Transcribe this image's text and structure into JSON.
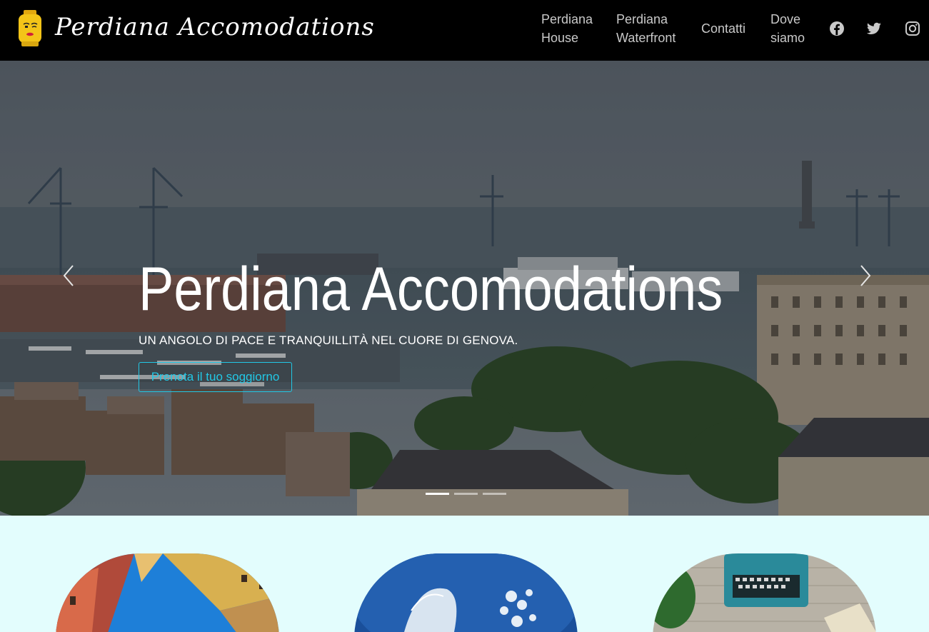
{
  "brand": {
    "name": "Perdiana Accomodations",
    "logo_icon": "lego-head-icon"
  },
  "nav": {
    "items": [
      {
        "line1": "Perdiana",
        "line2": "House"
      },
      {
        "line1": "Perdiana",
        "line2": "Waterfront"
      },
      {
        "line1": "Contatti",
        "line2": ""
      },
      {
        "line1": "Dove",
        "line2": "siamo"
      }
    ],
    "social_icons": [
      "facebook-icon",
      "twitter-icon",
      "instagram-icon"
    ]
  },
  "hero": {
    "title": "Perdiana Accomodations",
    "subtitle": "UN ANGOLO DI PACE E TRANQUILLITÀ NEL CUORE DI GENOVA.",
    "cta_label": "Prenota il tuo soggiorno",
    "slides_count": 3,
    "active_slide": 1,
    "prev_icon": "chevron-left-icon",
    "next_icon": "chevron-right-icon"
  },
  "colors": {
    "accent": "#22c8e6",
    "navbar_bg": "#000000",
    "section_bg": "#e3fdfd"
  }
}
